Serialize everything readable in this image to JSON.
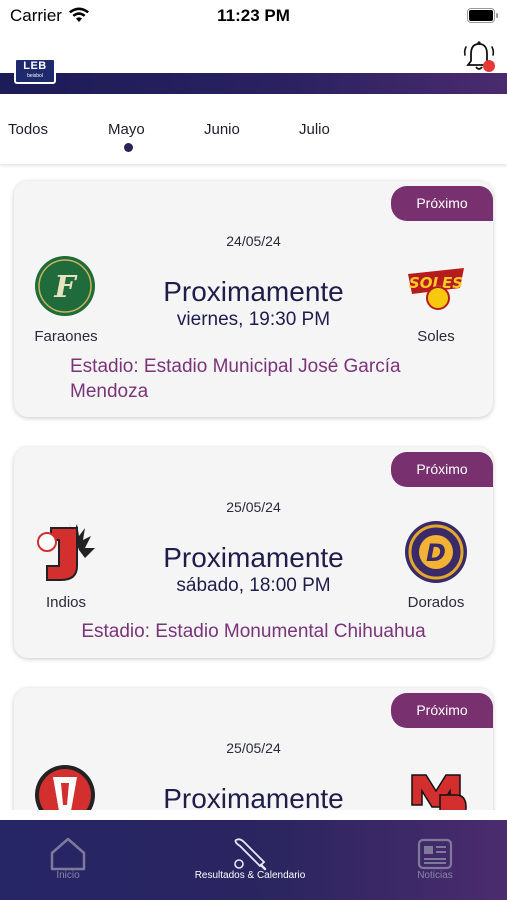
{
  "status_bar": {
    "carrier": "Carrier",
    "time": "11:23 PM"
  },
  "header": {
    "logo_text": "LEB",
    "logo_subtext": "beisbol",
    "notification_icon": "bell-icon",
    "accent_color": "#79306f",
    "band_color": "#1c1c57"
  },
  "tabs": {
    "items": [
      "Todos",
      "Mayo",
      "Junio",
      "Julio"
    ],
    "selected": "Mayo"
  },
  "games": [
    {
      "badge": "Próximo",
      "date": "24/05/24",
      "status": "Proximamente",
      "time": "viernes, 19:30 PM",
      "home_team": "Faraones",
      "away_team": "Soles",
      "home_logo_text": "F",
      "away_logo_text": "SOLES",
      "venue": "Estadio: Estadio Municipal José García Mendoza"
    },
    {
      "badge": "Próximo",
      "date": "25/05/24",
      "status": "Proximamente",
      "time": "sábado, 18:00 PM",
      "home_team": "Indios",
      "away_team": "Dorados",
      "home_logo_text": "J",
      "away_logo_text": "D",
      "venue": "Estadio: Estadio Monumental Chihuahua"
    },
    {
      "badge": "Próximo",
      "date": "25/05/24",
      "status": "Proximamente",
      "time": "",
      "home_team": "",
      "away_team": "",
      "away_logo_text": "MD",
      "venue": ""
    }
  ],
  "bottom_nav": {
    "items": [
      {
        "label": "Inicio",
        "icon": "home-icon",
        "active": false
      },
      {
        "label": "Resultados & Calendario",
        "icon": "baseball-bat-icon",
        "active": true
      },
      {
        "label": "Noticias",
        "icon": "newspaper-icon",
        "active": false
      }
    ]
  }
}
